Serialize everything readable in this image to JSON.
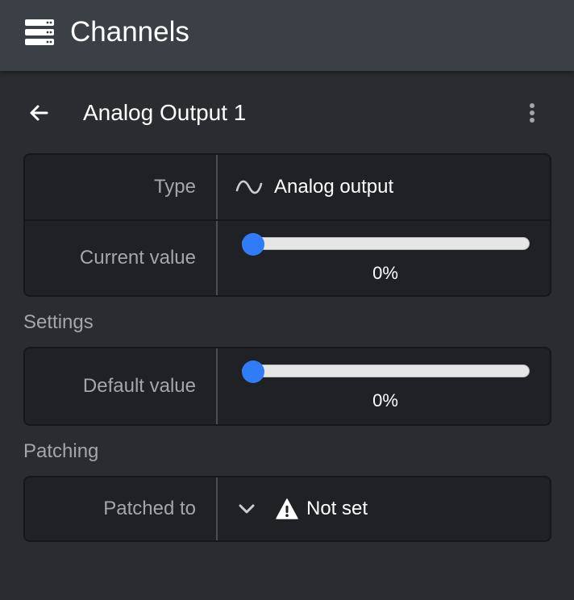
{
  "header": {
    "title": "Channels",
    "icon": "server-icon"
  },
  "page": {
    "title": "Analog Output 1",
    "back_icon": "arrow-left-icon",
    "menu_icon": "more-vertical-icon"
  },
  "info": {
    "type_label": "Type",
    "type_value": "Analog output",
    "type_icon": "sine-wave-icon",
    "current_label": "Current value",
    "current_value": 0,
    "current_text": "0%"
  },
  "settings": {
    "title": "Settings",
    "default_label": "Default value",
    "default_value": 0,
    "default_text": "0%"
  },
  "patching": {
    "title": "Patching",
    "patched_label": "Patched to",
    "patched_value": "Not set",
    "warning_icon": "warning-icon"
  },
  "colors": {
    "accent": "#2f7cf6",
    "header_bg": "#3b3f46",
    "page_bg": "#2a2c31",
    "panel_bg": "#202125"
  }
}
